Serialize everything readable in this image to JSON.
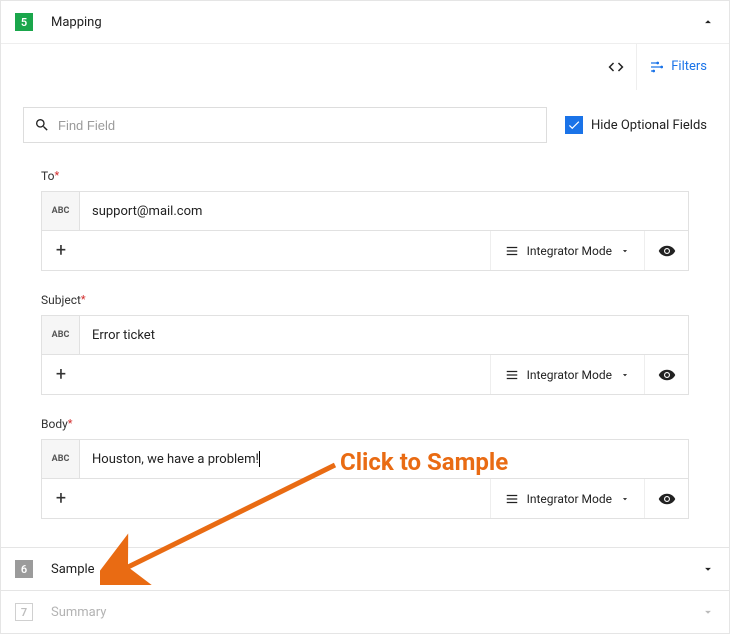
{
  "steps": {
    "mapping": {
      "number": "5",
      "title": "Mapping"
    },
    "sample": {
      "number": "6",
      "title": "Sample"
    },
    "summary": {
      "number": "7",
      "title": "Summary"
    }
  },
  "toolbar": {
    "filters_label": "Filters"
  },
  "search": {
    "placeholder": "Find Field",
    "hide_optional_label": "Hide Optional Fields"
  },
  "type_badge": "ABC",
  "mode_label": "Integrator Mode",
  "fields": [
    {
      "label": "To",
      "required": true,
      "value": "support@mail.com"
    },
    {
      "label": "Subject",
      "required": true,
      "value": "Error ticket"
    },
    {
      "label": "Body",
      "required": true,
      "value": "Houston, we have a problem!"
    }
  ],
  "annotation": {
    "text": "Click to Sample"
  }
}
